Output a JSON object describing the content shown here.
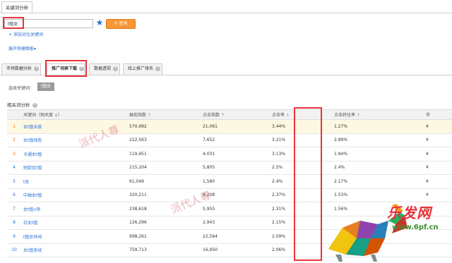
{
  "top_tab": "关键词分析",
  "search": {
    "value": "t恤女",
    "button_label": "查询"
  },
  "add_link": "添加对比关键词",
  "quick_link": "展开快捷面板▾",
  "tabs": [
    {
      "label": "市场数据分析"
    },
    {
      "label": "推广词表下载"
    },
    {
      "label": "数据透视"
    },
    {
      "label": "线上推广排名"
    }
  ],
  "selected": {
    "label": "选择关键词：",
    "chip": "t恤女"
  },
  "section_title": "相关词分析",
  "table": {
    "headers": [
      "关键词（相关度 ↓）",
      "展现指数",
      "点击指数",
      "点击率",
      "点击转化率",
      "市"
    ],
    "rows": [
      {
        "rank": "1",
        "keyword": "女t恤长款",
        "impressions": "570,992",
        "clicks": "21,061",
        "ctr": "3.44%",
        "cvr": "1.27%",
        "tail": "¥"
      },
      {
        "rank": "2",
        "keyword": "女t恤纯色",
        "impressions": "222,563",
        "clicks": "7,652",
        "ctr": "3.21%",
        "cvr": "2.89%",
        "tail": "¥"
      },
      {
        "rank": "3",
        "keyword": "卡通女t恤",
        "impressions": "119,951",
        "clicks": "4,031",
        "ctr": "3.13%",
        "cvr": "1.94%",
        "tail": "¥"
      },
      {
        "rank": "4",
        "keyword": "短款女t恤",
        "impressions": "215,204",
        "clicks": "5,805",
        "ctr": "2.5%",
        "cvr": "2.4%",
        "tail": "¥"
      },
      {
        "rank": "5",
        "keyword": "t女",
        "impressions": "61,049",
        "clicks": "1,580",
        "ctr": "2.4%",
        "cvr": "2.17%",
        "tail": "¥"
      },
      {
        "rank": "6",
        "keyword": "中袖女t恤",
        "impressions": "320,211",
        "clicks": "8,208",
        "ctr": "2.37%",
        "cvr": "1.53%",
        "tail": "¥"
      },
      {
        "rank": "7",
        "keyword": "女t恤v领",
        "impressions": "238,618",
        "clicks": "5,955",
        "ctr": "2.31%",
        "cvr": "1.56%",
        "tail": "¥"
      },
      {
        "rank": "8",
        "keyword": "白女t恤",
        "impressions": "126,296",
        "clicks": "2,943",
        "ctr": "2.15%",
        "cvr": "",
        "tail": ""
      },
      {
        "rank": "9",
        "keyword": "t恤女休闲",
        "impressions": "998,261",
        "clicks": "22,564",
        "ctr": "2.09%",
        "cvr": "",
        "tail": ""
      },
      {
        "rank": "10",
        "keyword": "女t恤条纹",
        "impressions": "759,713",
        "clicks": "16,950",
        "ctr": "2.06%",
        "cvr": "",
        "tail": ""
      }
    ]
  },
  "watermarks": [
    "派代人尊",
    "派代人尊"
  ],
  "logo": {
    "text": "乐发网",
    "url": "www.6pf.cn"
  },
  "colors": {
    "accent_blue": "#2a6fd1",
    "search_orange": "#f79635",
    "highlight_red": "#e8333a",
    "row_highlight": "#fdf8e1"
  }
}
